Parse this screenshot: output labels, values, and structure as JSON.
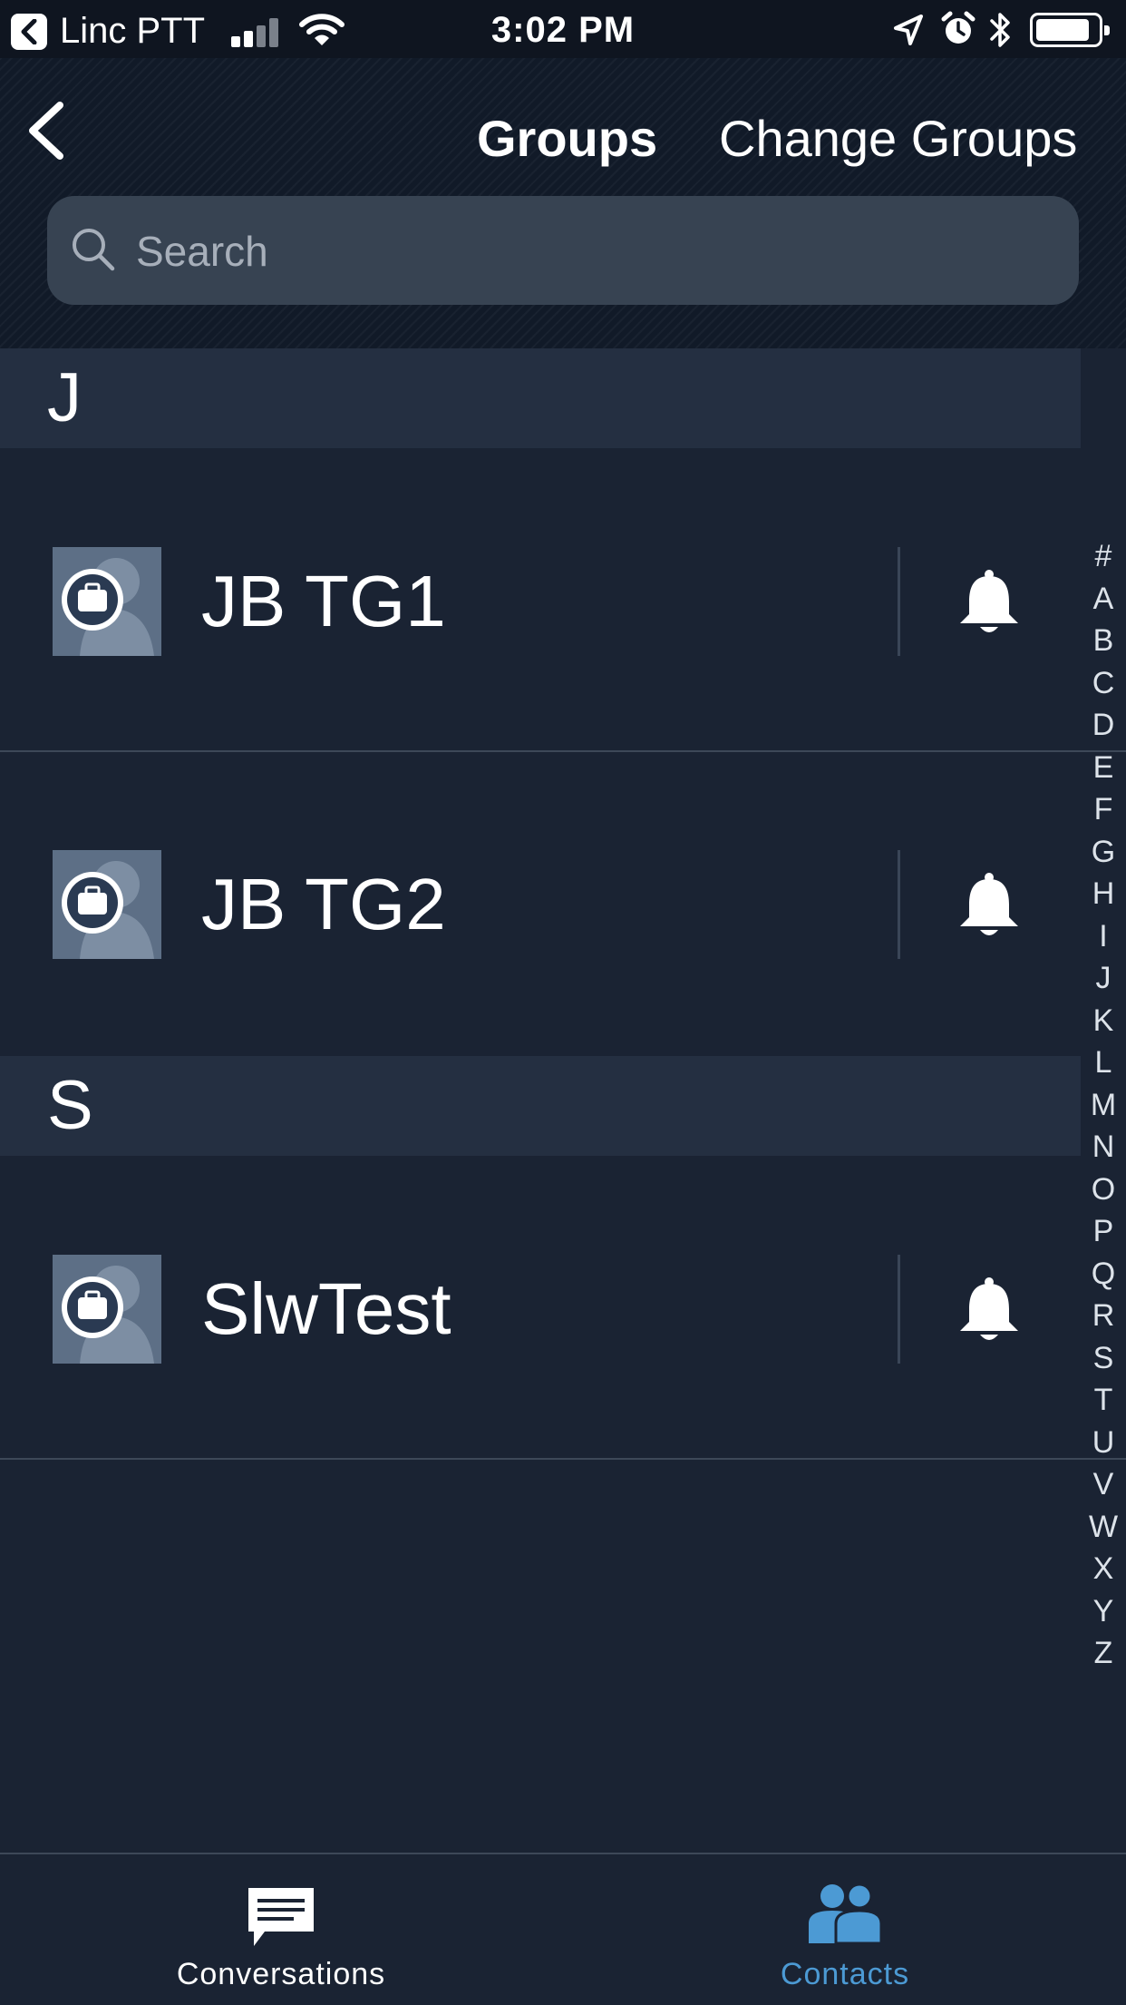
{
  "status_bar": {
    "back_app": "Linc PTT",
    "time": "3:02 PM"
  },
  "header": {
    "tabs": [
      {
        "label": "Groups",
        "active": true
      },
      {
        "label": "Change Groups",
        "active": false
      }
    ]
  },
  "search": {
    "placeholder": "Search",
    "value": ""
  },
  "sections": [
    {
      "letter": "J",
      "items": [
        {
          "name": "JB TG1",
          "icon": "bell-icon"
        },
        {
          "name": "JB TG2",
          "icon": "bell-icon"
        }
      ]
    },
    {
      "letter": "S",
      "items": [
        {
          "name": "SlwTest",
          "icon": "bell-icon"
        }
      ]
    }
  ],
  "index": [
    "#",
    "A",
    "B",
    "C",
    "D",
    "E",
    "F",
    "G",
    "H",
    "I",
    "J",
    "K",
    "L",
    "M",
    "N",
    "O",
    "P",
    "Q",
    "R",
    "S",
    "T",
    "U",
    "V",
    "W",
    "X",
    "Y",
    "Z"
  ],
  "tabbar": {
    "conversations_label": "Conversations",
    "contacts_label": "Contacts",
    "active": "Contacts",
    "active_color": "#4c9ad4"
  }
}
